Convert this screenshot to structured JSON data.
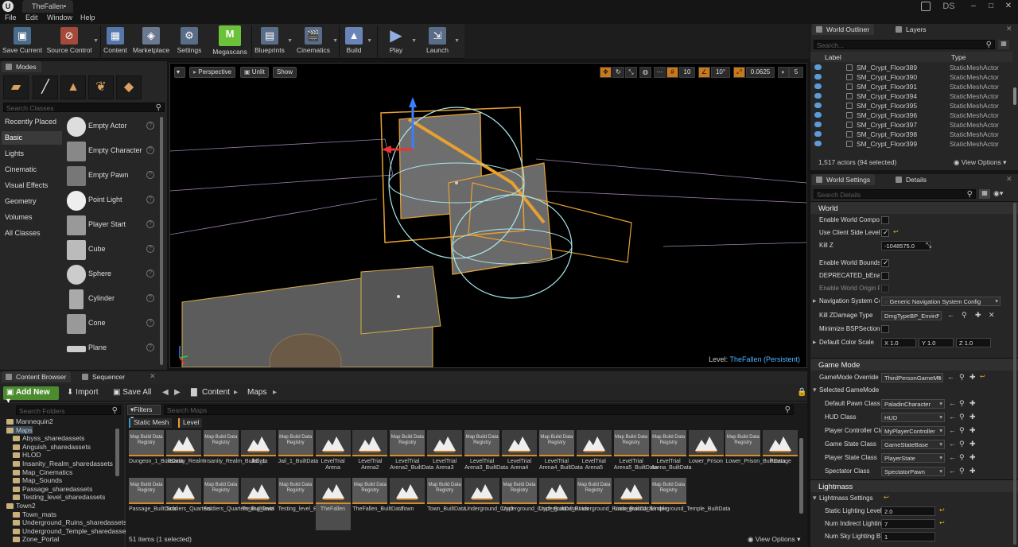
{
  "window": {
    "tab_title": "TheFallen•",
    "user_initials": "DS",
    "logo": "U"
  },
  "menu": [
    "File",
    "Edit",
    "Window",
    "Help"
  ],
  "toolbar": [
    {
      "label": "Save Current",
      "icon": "save-icon"
    },
    {
      "label": "Source Control",
      "icon": "source-control-icon"
    },
    {
      "label": "Content",
      "icon": "content-icon"
    },
    {
      "label": "Marketplace",
      "icon": "marketplace-icon"
    },
    {
      "label": "Settings",
      "icon": "settings-icon"
    },
    {
      "label": "Megascans",
      "icon": "megascans-icon"
    },
    {
      "label": "Blueprints",
      "icon": "blueprints-icon"
    },
    {
      "label": "Cinematics",
      "icon": "cinematics-icon"
    },
    {
      "label": "Build",
      "icon": "build-icon"
    },
    {
      "label": "Play",
      "icon": "play-icon"
    },
    {
      "label": "Launch",
      "icon": "launch-icon"
    }
  ],
  "modes": {
    "tab": "Modes",
    "search_placeholder": "Search Classes",
    "categories": [
      "Recently Placed",
      "Basic",
      "Lights",
      "Cinematic",
      "Visual Effects",
      "Geometry",
      "Volumes",
      "All Classes"
    ],
    "selected_category": "Basic",
    "items": [
      "Empty Actor",
      "Empty Character",
      "Empty Pawn",
      "Point Light",
      "Player Start",
      "Cube",
      "Sphere",
      "Cylinder",
      "Cone",
      "Plane"
    ]
  },
  "viewport": {
    "perspective": "Perspective",
    "lit": "Unlit",
    "show": "Show",
    "grid_snap": "10",
    "rot_snap": "10°",
    "scale_snap": "0.0625",
    "cam_speed": "5",
    "level_label": "Level:",
    "level_name": "TheFallen (Persistent)"
  },
  "content_browser": {
    "tabs": [
      "Content Browser",
      "Sequencer"
    ],
    "add_new": "Add New",
    "import": "Import",
    "save_all": "Save All",
    "path": [
      "Content",
      "Maps"
    ],
    "folder_search": "Search Folders",
    "asset_search": "Search Maps",
    "filters": "Filters",
    "filter_chips": [
      "Static Mesh",
      "Level"
    ],
    "folders": [
      "Mannequin2",
      "Maps",
      "Abyss_sharedassets",
      "Anguish_sharedassets",
      "HLOD",
      "Insanity_Realm_sharedassets",
      "Map_Cinematics",
      "Map_Sounds",
      "Passage_sharedassets",
      "Testing_level_sharedassets",
      "Town2",
      "Town_mats",
      "Underground_Ruins_sharedassets",
      "Underground_Temple_sharedassets",
      "Zone_Portal"
    ],
    "row1": [
      {
        "name": "Dungeon_1_BuiltData",
        "registry": true
      },
      {
        "name": "Insanity_Realm",
        "registry": false
      },
      {
        "name": "Insanity_Realm_BuiltData",
        "registry": true
      },
      {
        "name": "Jail_1",
        "registry": false
      },
      {
        "name": "Jail_1_BuiltData",
        "registry": true
      },
      {
        "name": "LevelTrial Arena",
        "registry": false
      },
      {
        "name": "LevelTrial Arena2",
        "registry": false
      },
      {
        "name": "LevelTrial Arena2_BuiltData",
        "registry": true
      },
      {
        "name": "LevelTrial Arena3",
        "registry": false
      },
      {
        "name": "LevelTrial Arena3_BuiltData",
        "registry": true
      },
      {
        "name": "LevelTrial Arena4",
        "registry": false
      },
      {
        "name": "LevelTrial Arena4_BuiltData",
        "registry": true
      },
      {
        "name": "LevelTrial Arena5",
        "registry": false
      },
      {
        "name": "LevelTrial Arena5_BuiltData",
        "registry": true
      },
      {
        "name": "LevelTrial Arena_BuiltData",
        "registry": true
      },
      {
        "name": "Lower_Prison",
        "registry": false
      },
      {
        "name": "Lower_Prison_BuiltData",
        "registry": true
      },
      {
        "name": "Passage",
        "registry": false
      }
    ],
    "row2": [
      {
        "name": "Passage_BuiltData",
        "registry": true
      },
      {
        "name": "Soldiers_Quarters",
        "registry": false
      },
      {
        "name": "Soldiers_Quarters_BuiltData",
        "registry": true
      },
      {
        "name": "Testing_level",
        "registry": false
      },
      {
        "name": "Testing_level_BuiltData",
        "registry": true
      },
      {
        "name": "TheFallen",
        "registry": false
      },
      {
        "name": "TheFallen_BuiltData",
        "registry": true
      },
      {
        "name": "Town",
        "registry": false
      },
      {
        "name": "Town_BuiltData",
        "registry": true
      },
      {
        "name": "Underground_Crypt",
        "registry": false
      },
      {
        "name": "Underground_Crypt_BuiltData",
        "registry": true
      },
      {
        "name": "Underground_Ruins",
        "registry": false
      },
      {
        "name": "Underground_Ruins_BuiltData",
        "registry": true
      },
      {
        "name": "Underground_Temple",
        "registry": false
      },
      {
        "name": "Underground_Temple_BuiltData",
        "registry": true
      }
    ],
    "registry_label": "Map Build Data Registry",
    "selected_asset": "TheFallen",
    "status": "51 items (1 selected)",
    "view_options": "View Options"
  },
  "outliner": {
    "tabs": [
      "World Outliner",
      "Layers"
    ],
    "search_placeholder": "Search...",
    "col_label": "Label",
    "col_type": "Type",
    "rows": [
      {
        "name": "SM_Crypt_Floor389",
        "type": "StaticMeshActor"
      },
      {
        "name": "SM_Crypt_Floor390",
        "type": "StaticMeshActor"
      },
      {
        "name": "SM_Crypt_Floor391",
        "type": "StaticMeshActor"
      },
      {
        "name": "SM_Crypt_Floor394",
        "type": "StaticMeshActor"
      },
      {
        "name": "SM_Crypt_Floor395",
        "type": "StaticMeshActor"
      },
      {
        "name": "SM_Crypt_Floor396",
        "type": "StaticMeshActor"
      },
      {
        "name": "SM_Crypt_Floor397",
        "type": "StaticMeshActor"
      },
      {
        "name": "SM_Crypt_Floor398",
        "type": "StaticMeshActor"
      },
      {
        "name": "SM_Crypt_Floor399",
        "type": "StaticMeshActor"
      }
    ],
    "count": "1,517 actors (94 selected)",
    "view_options": "View Options"
  },
  "details": {
    "tabs": [
      "World Settings",
      "Details"
    ],
    "search_placeholder": "Search Details",
    "world": {
      "title": "World",
      "enable_world_composition": "Enable World Composi",
      "use_client_side": "Use Client Side Level S",
      "kill_z": "Kill Z",
      "kill_z_value": "-1048575.0",
      "enable_world_bounds": "Enable World Bounds C",
      "deprecated": "DEPRECATED_bEnable",
      "enable_world_origin": "Enable World Origin Re",
      "nav_system": "Navigation System Co",
      "nav_system_value": "Generic Navigation System Config",
      "kill_zdamage": "Kill ZDamage Type",
      "kill_zdamage_value": "DmgTypeBP_Enviro",
      "minimize_bsp": "Minimize BSPSections",
      "default_color_scale": "Default Color Scale",
      "x": "X",
      "x_val": "1.0",
      "y": "Y",
      "y_val": "1.0",
      "z": "Z",
      "z_val": "1.0"
    },
    "game_mode": {
      "title": "Game Mode",
      "override_label": "GameMode Override",
      "override_value": "ThirdPersonGameMo",
      "selected_label": "Selected GameMode",
      "pawn_label": "Default Pawn Class",
      "pawn_value": "PaladinCharacter",
      "hud_label": "HUD Class",
      "hud_value": "HUD",
      "pc_label": "Player Controller Class",
      "pc_value": "MyPlayerController",
      "gs_label": "Game State Class",
      "gs_value": "GameStateBase",
      "ps_label": "Player State Class",
      "ps_value": "PlayerState",
      "spec_label": "Spectator Class",
      "spec_value": "SpectatorPawn"
    },
    "lightmass": {
      "title": "Lightmass",
      "settings": "Lightmass Settings",
      "static_label": "Static Lighting Level",
      "static_value": "2.0",
      "indirect_label": "Num Indirect Lightin",
      "indirect_value": "7",
      "sky_label": "Num Sky Lighting B",
      "sky_value": "1"
    }
  }
}
